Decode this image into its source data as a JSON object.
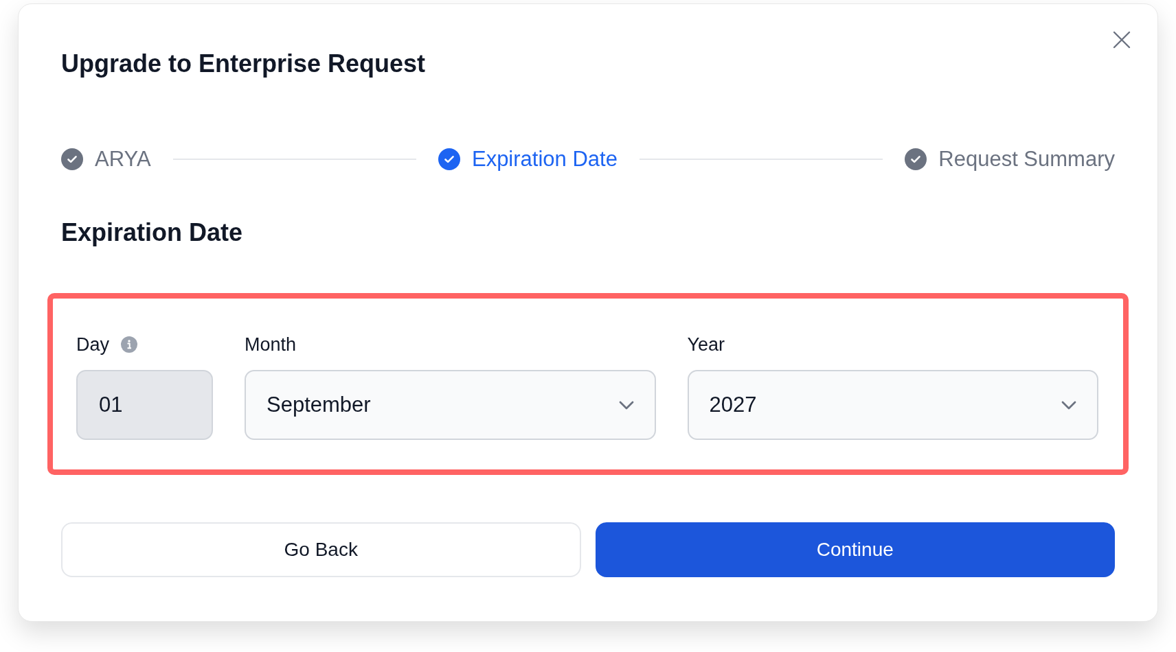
{
  "dialog": {
    "title": "Upgrade to Enterprise Request"
  },
  "steps": [
    {
      "label": "ARYA",
      "selected": false
    },
    {
      "label": "Expiration Date",
      "selected": true
    },
    {
      "label": "Request Summary",
      "selected": false
    }
  ],
  "section": {
    "heading": "Expiration Date",
    "highlighted": true,
    "fields": [
      {
        "kind": "input",
        "label": "Day",
        "value": "01",
        "disabled": true,
        "info": true
      },
      {
        "kind": "select",
        "label": "Month",
        "value": "September"
      },
      {
        "kind": "select",
        "label": "Year",
        "value": "2027"
      }
    ]
  },
  "buttons": [
    {
      "kind": "secondary",
      "label": "Go Back"
    },
    {
      "kind": "primary",
      "label": "Continue"
    }
  ]
}
